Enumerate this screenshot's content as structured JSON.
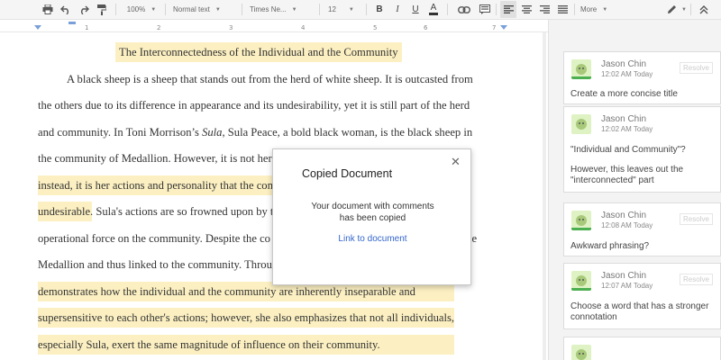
{
  "toolbar": {
    "icons": [
      "printer-icon",
      "undo-icon",
      "redo-icon",
      "paint-format-icon"
    ],
    "zoom": "100%",
    "style": "Normal text",
    "font": "Times Ne...",
    "size": "12",
    "bold": "B",
    "italic": "I",
    "underline": "U",
    "text_color_glyph": "A",
    "more": "More",
    "accent": "#4a8af4"
  },
  "ruler": {
    "ticks": [
      "1",
      "2",
      "3",
      "4",
      "5",
      "6",
      "7"
    ]
  },
  "document": {
    "lines": [
      "The Interconnectedness of the Individual and the Community",
      "A black sheep is a sheep that stands out from the herd of white sheep. It is outcasted from",
      "the others due to its difference in appearance and its undesirability, yet it is still part of the herd",
      "and community. In Toni Morrison’s ",
      "Sula",
      ", Sula Peace, a bold black woman, is the black sheep in",
      "the community of Medallion. However, it is not her",
      "instead, it is her actions and personality that the com",
      "undesirable. Sula's actions are so frowned upon by t",
      "operational force on the community. Despite the co",
      "Medallion and thus linked to the community. Throu",
      "demonstrates how the individual and the community are inherently inseparable and",
      "supersensitive to each other's actions; however, she also emphasizes that not all individuals,",
      "especially Sula, exert the same magnitude of influence on their community.",
      ":",
      "le"
    ],
    "highlight_color": "#fcf0c2"
  },
  "comments": [
    {
      "author": "Jason Chin",
      "time": "12:02 AM Today",
      "resolve": "Resolve",
      "body": [
        "Create a more concise title"
      ]
    },
    {
      "author": "Jason Chin",
      "time": "12:02 AM Today",
      "body": [
        "\"Individual and Community\"?",
        "",
        "However, this leaves out the",
        "\"interconnected\" part"
      ]
    },
    {
      "author": "Jason Chin",
      "time": "12:08 AM Today",
      "resolve": "Resolve",
      "body": [
        "Awkward phrasing?"
      ]
    },
    {
      "author": "Jason Chin",
      "time": "12:07 AM Today",
      "resolve": "Resolve",
      "body": [
        "Choose a word that has a stronger",
        "connotation"
      ]
    }
  ],
  "dialog": {
    "title": "Copied Document",
    "message_line1": "Your document with comments",
    "message_line2": "has been copied",
    "link": "Link to document",
    "close": "✕"
  }
}
